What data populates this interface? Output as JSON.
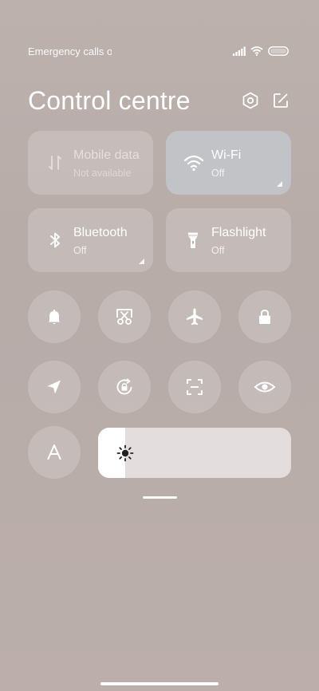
{
  "status": {
    "text": "Emergency calls o"
  },
  "header": {
    "title": "Control centre",
    "settings_icon": "settings-hexagon-icon",
    "edit_icon": "edit-icon"
  },
  "tiles": [
    {
      "label": "Mobile data",
      "sub": "Not available",
      "icon": "mobile-data-icon",
      "state": "disabled"
    },
    {
      "label": "Wi-Fi",
      "sub": "Off",
      "icon": "wifi-icon",
      "state": "active"
    },
    {
      "label": "Bluetooth",
      "sub": "Off",
      "icon": "bluetooth-icon",
      "state": "normal"
    },
    {
      "label": "Flashlight",
      "sub": "Off",
      "icon": "flashlight-icon",
      "state": "normal"
    }
  ],
  "toggles": [
    "bell-icon",
    "screenshot-icon",
    "airplane-icon",
    "lock-icon",
    "location-icon",
    "rotation-lock-icon",
    "scan-icon",
    "eye-icon",
    "font-size-icon"
  ],
  "brightness": {
    "icon": "sun-icon",
    "level": 0.14
  },
  "colors": {
    "background": "#b9adaa",
    "tile": "rgba(255,255,255,0.18)",
    "active_tile": "#c8d6de"
  }
}
